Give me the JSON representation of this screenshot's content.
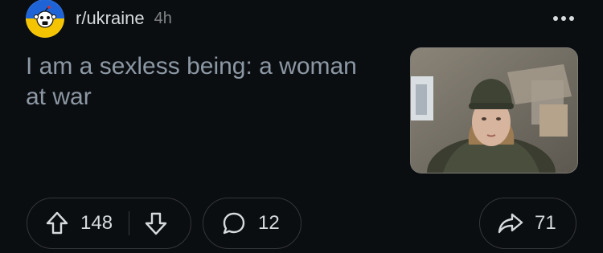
{
  "post": {
    "subreddit": "r/ukraine",
    "age": "4h",
    "title": "I am a sexless being: a woman at war",
    "thumbnail_icon": "photo-soldier-woman-helmet",
    "upvotes": "148",
    "comments": "12",
    "shares": "71"
  },
  "colors": {
    "background": "#0b0e11",
    "title": "#8c98a4",
    "border": "#343536",
    "ukraine_blue": "#1f64d6",
    "ukraine_yellow": "#f5c400"
  },
  "icons": {
    "avatar": "subreddit-avatar-snoo",
    "more": "more-dots-icon",
    "upvote": "upvote-arrow-icon",
    "downvote": "downvote-arrow-icon",
    "comment": "comment-bubble-icon",
    "share": "share-arrow-icon"
  }
}
